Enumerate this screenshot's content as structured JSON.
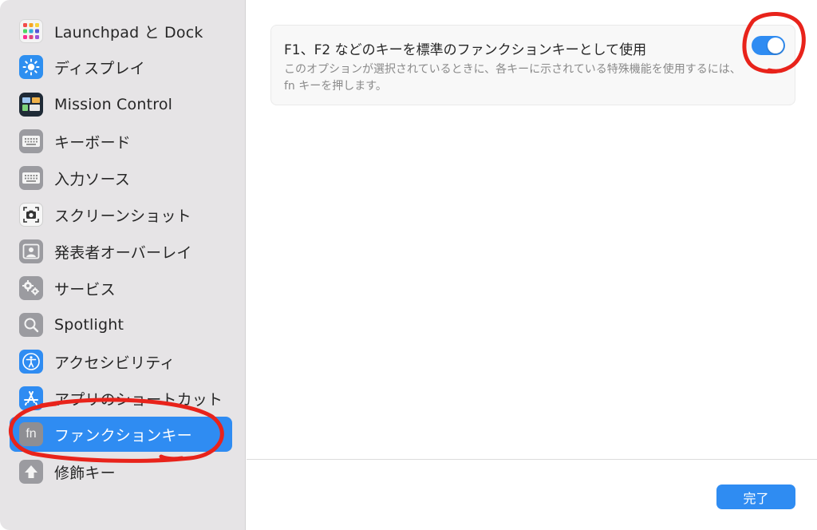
{
  "sidebar": {
    "items": [
      {
        "label": "Launchpad と Dock",
        "icon": "launchpad-icon"
      },
      {
        "label": "ディスプレイ",
        "icon": "sun-icon"
      },
      {
        "label": "Mission Control",
        "icon": "mission-control-icon"
      },
      {
        "label": "キーボード",
        "icon": "keyboard-icon"
      },
      {
        "label": "入力ソース",
        "icon": "keyboard-icon"
      },
      {
        "label": "スクリーンショット",
        "icon": "camera-icon"
      },
      {
        "label": "発表者オーバーレイ",
        "icon": "presenter-icon"
      },
      {
        "label": "サービス",
        "icon": "gear-icon"
      },
      {
        "label": "Spotlight",
        "icon": "magnifier-icon"
      },
      {
        "label": "アクセシビリティ",
        "icon": "accessibility-icon"
      },
      {
        "label": "アプリのショートカット",
        "icon": "app-store-icon"
      },
      {
        "label": "ファンクションキー",
        "icon": "fn-icon",
        "icon_text": "fn",
        "selected": true
      },
      {
        "label": "修飾キー",
        "icon": "arrow-up-icon"
      }
    ]
  },
  "main": {
    "option": {
      "title": "F1、F2 などのキーを標準のファンクションキーとして使用",
      "description": "このオプションが選択されているときに、各キーに示されている特殊機能を使用するには、fn キーを押します。",
      "enabled": true
    },
    "done_label": "完了"
  },
  "colors": {
    "accent": "#2f8cf2",
    "sidebar_bg": "#e6e4e6",
    "annotation_red": "#e8231b"
  }
}
